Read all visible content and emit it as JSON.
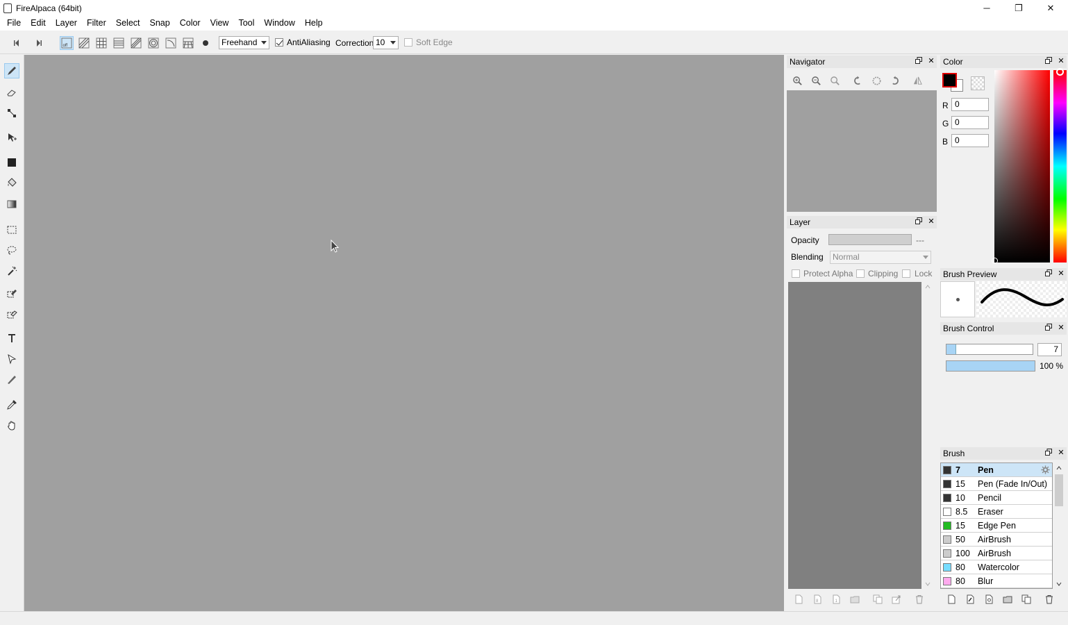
{
  "window": {
    "title": "FireAlpaca (64bit)",
    "minimize_glyph": "─",
    "restore_glyph": "❐",
    "close_glyph": "✕"
  },
  "menu": [
    "File",
    "Edit",
    "Layer",
    "Filter",
    "Select",
    "Snap",
    "Color",
    "View",
    "Tool",
    "Window",
    "Help"
  ],
  "toolbar": {
    "stroke_mode": "Freehand",
    "antialiasing_label": "AntiAliasing",
    "antialiasing_checked": true,
    "correction_label": "Correction",
    "correction_value": "10",
    "soft_edge_label": "Soft Edge",
    "soft_edge_checked": false,
    "snap_off_label": "off"
  },
  "navigator": {
    "title": "Navigator",
    "float_glyph": "🗗",
    "close_glyph": "✕"
  },
  "layer": {
    "title": "Layer",
    "opacity_label": "Opacity",
    "opacity_value": "---",
    "blending_label": "Blending",
    "blending_value": "Normal",
    "protect_alpha_label": "Protect Alpha",
    "clipping_label": "Clipping",
    "lock_label": "Lock"
  },
  "color": {
    "title": "Color",
    "r_label": "R",
    "r_value": "0",
    "g_label": "G",
    "g_value": "0",
    "b_label": "B",
    "b_value": "0",
    "primary": "#000000",
    "secondary": "#ffffff"
  },
  "brush_preview": {
    "title": "Brush Preview"
  },
  "brush_control": {
    "title": "Brush Control",
    "size_value": "7",
    "opacity_value": "100 %",
    "opacity_fraction": 1.0
  },
  "brush": {
    "title": "Brush",
    "items": [
      {
        "size": "7",
        "name": "Pen",
        "color": "#333333"
      },
      {
        "size": "15",
        "name": "Pen (Fade In/Out)",
        "color": "#333333"
      },
      {
        "size": "10",
        "name": "Pencil",
        "color": "#333333"
      },
      {
        "size": "8.5",
        "name": "Eraser",
        "color": "#ffffff"
      },
      {
        "size": "15",
        "name": "Edge Pen",
        "color": "#22bb22"
      },
      {
        "size": "50",
        "name": "AirBrush",
        "color": "#cccccc"
      },
      {
        "size": "100",
        "name": "AirBrush",
        "color": "#cccccc"
      },
      {
        "size": "80",
        "name": "Watercolor",
        "color": "#77ddff"
      },
      {
        "size": "80",
        "name": "Blur",
        "color": "#ffaaee"
      }
    ]
  }
}
